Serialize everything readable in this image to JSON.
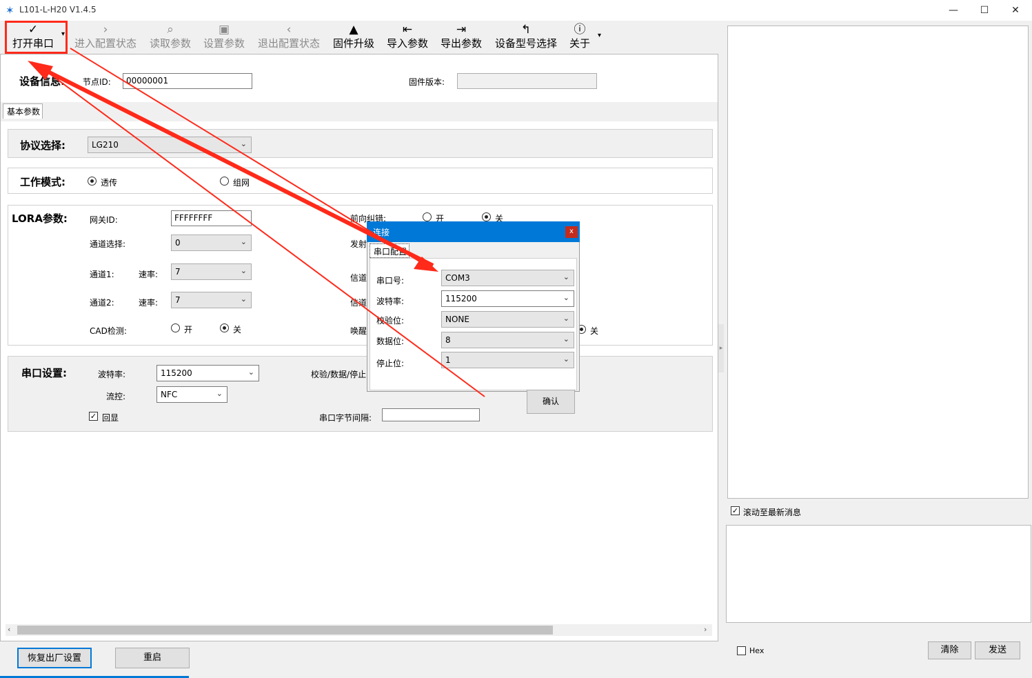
{
  "window": {
    "title": "L101-L-H20 V1.4.5",
    "controls": [
      "—",
      "☐",
      "✕"
    ]
  },
  "toolbar": {
    "items": [
      {
        "label": "打开串口",
        "icon": "✓"
      },
      {
        "label": "进入配置状态",
        "icon": "›"
      },
      {
        "label": "读取参数",
        "icon": "⌕"
      },
      {
        "label": "设置参数",
        "icon": "▣"
      },
      {
        "label": "退出配置状态",
        "icon": "‹"
      },
      {
        "label": "固件升级",
        "icon": "▲"
      },
      {
        "label": "导入参数",
        "icon": "⇤"
      },
      {
        "label": "导出参数",
        "icon": "⇥"
      },
      {
        "label": "设备型号选择",
        "icon": "↰"
      },
      {
        "label": "关于",
        "icon": "ⓘ"
      }
    ],
    "dropdown_glyph": "▾"
  },
  "device_info": {
    "heading": "设备信息:",
    "node_id_label": "节点ID:",
    "node_id_value": "00000001",
    "firmware_label": "固件版本:",
    "firmware_value": ""
  },
  "tab": {
    "label": "基本参数"
  },
  "protocol": {
    "label": "协议选择:",
    "value": "LG210"
  },
  "work_mode": {
    "label": "工作模式:",
    "option1": "透传",
    "option2": "组网"
  },
  "lora": {
    "heading": "LORA参数:",
    "gateway_id_label": "网关ID:",
    "gateway_id_value": "FFFFFFFF",
    "channel_select_label": "通道选择:",
    "channel_select_value": "0",
    "channel1_label": "通道1:",
    "channel2_label": "通道2:",
    "rate_label": "速率:",
    "rate1_value": "7",
    "rate2_value": "7",
    "cad_label": "CAD检测:",
    "on": "开",
    "off": "关",
    "fec_label": "前向纠错:",
    "tx_label": "发射",
    "ch_label_a": "信道",
    "ch_label_b": "信道",
    "wake_label": "唤醒"
  },
  "serial": {
    "heading": "串口设置:",
    "baud_label": "波特率:",
    "baud_value": "115200",
    "flow_label": "流控:",
    "flow_value": "NFC",
    "echo_label": "回显",
    "parity_label": "校验/数据/停止",
    "byte_interval_label": "串口字节间隔:"
  },
  "bottom_buttons": {
    "restore": "恢复出厂设置",
    "restart": "重启"
  },
  "right": {
    "scroll_label": "滚动至最新消息",
    "hex_label": "Hex",
    "clear": "清除",
    "send": "发送"
  },
  "dialog": {
    "title": "连接",
    "close": "x",
    "tab": "串口配置",
    "port_label": "串口号:",
    "port_value": "COM3",
    "baud_label": "波特率:",
    "baud_value": "115200",
    "parity_label": "校验位:",
    "parity_value": "NONE",
    "data_label": "数据位:",
    "data_value": "8",
    "stop_label": "停止位:",
    "stop_value": "1",
    "confirm": "确认"
  },
  "colors": {
    "annotation": "#ff2a1a",
    "title_bar_blue": "#0078d7"
  }
}
